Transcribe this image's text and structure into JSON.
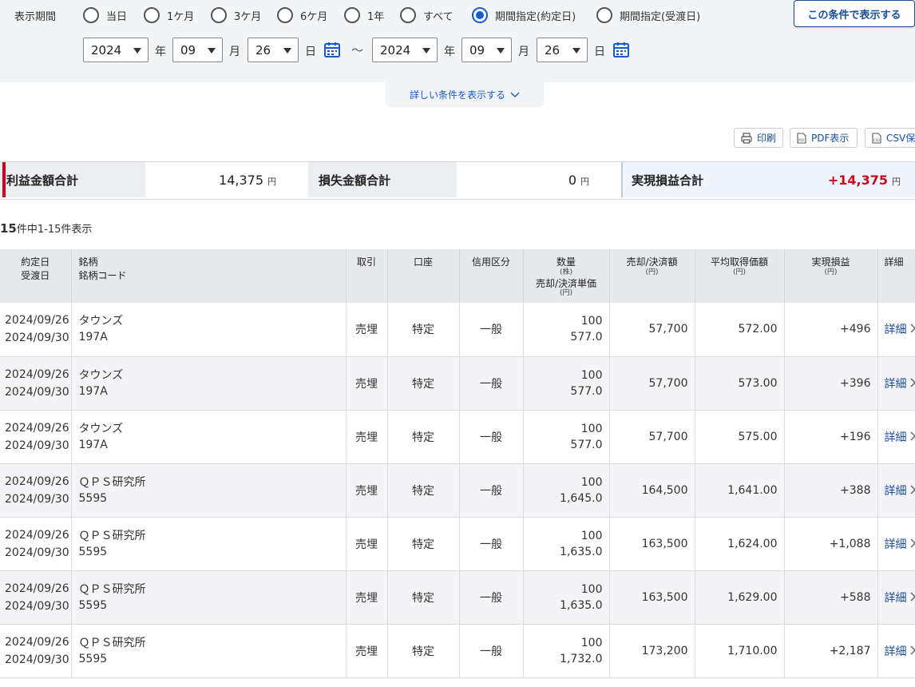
{
  "filter": {
    "period_label": "表示期間",
    "options": [
      "当日",
      "1ケ月",
      "3ケ月",
      "6ケ月",
      "1年",
      "すべて",
      "期間指定(約定日)",
      "期間指定(受渡日)"
    ],
    "selected_option": "期間指定(約定日)",
    "apply_button": "この条件で表示する",
    "from": {
      "year": "2024",
      "month": "09",
      "day": "26"
    },
    "to": {
      "year": "2024",
      "month": "09",
      "day": "26"
    },
    "unit_year": "年",
    "unit_month": "月",
    "unit_day": "日",
    "tilde": "～",
    "more_conditions": "詳しい条件を表示する"
  },
  "toolbar": {
    "print": "印刷",
    "pdf": "PDF表示",
    "csv": "CSV保存"
  },
  "summary": {
    "profit_label": "利益金額合計",
    "profit_value": "14,375",
    "loss_label": "損失金額合計",
    "loss_value": "0",
    "realized_label": "実現損益合計",
    "realized_value": "+14,375",
    "yen": "円"
  },
  "result_count": {
    "total": "15",
    "text": "件中1-15件表示"
  },
  "table": {
    "headers": {
      "trade_date": "約定日",
      "settle_date": "受渡日",
      "name": "銘柄",
      "code": "銘柄コード",
      "trade": "取引",
      "account": "口座",
      "margin": "信用区分",
      "qty": "数量",
      "qty_unit": "(株)",
      "unit_price": "売却/決済単価",
      "unit_price_unit": "(円)",
      "amount": "売却/決済額",
      "amount_unit": "(円)",
      "avg_cost": "平均取得価額",
      "avg_cost_unit": "(円)",
      "pl": "実現損益",
      "pl_unit": "(円)",
      "detail": "詳細"
    },
    "rows": [
      {
        "trade_date": "2024/09/26",
        "settle_date": "2024/09/30",
        "name": "タウンズ",
        "code": "197A",
        "trade": "売埋",
        "account": "特定",
        "margin": "一般",
        "qty": "100",
        "price": "577.0",
        "amount": "57,700",
        "avg": "572.00",
        "pl": "+496",
        "detail": "詳細"
      },
      {
        "trade_date": "2024/09/26",
        "settle_date": "2024/09/30",
        "name": "タウンズ",
        "code": "197A",
        "trade": "売埋",
        "account": "特定",
        "margin": "一般",
        "qty": "100",
        "price": "577.0",
        "amount": "57,700",
        "avg": "573.00",
        "pl": "+396",
        "detail": "詳細"
      },
      {
        "trade_date": "2024/09/26",
        "settle_date": "2024/09/30",
        "name": "タウンズ",
        "code": "197A",
        "trade": "売埋",
        "account": "特定",
        "margin": "一般",
        "qty": "100",
        "price": "577.0",
        "amount": "57,700",
        "avg": "575.00",
        "pl": "+196",
        "detail": "詳細"
      },
      {
        "trade_date": "2024/09/26",
        "settle_date": "2024/09/30",
        "name": "ＱＰＳ研究所",
        "code": "5595",
        "trade": "売埋",
        "account": "特定",
        "margin": "一般",
        "qty": "100",
        "price": "1,645.0",
        "amount": "164,500",
        "avg": "1,641.00",
        "pl": "+388",
        "detail": "詳細"
      },
      {
        "trade_date": "2024/09/26",
        "settle_date": "2024/09/30",
        "name": "ＱＰＳ研究所",
        "code": "5595",
        "trade": "売埋",
        "account": "特定",
        "margin": "一般",
        "qty": "100",
        "price": "1,635.0",
        "amount": "163,500",
        "avg": "1,624.00",
        "pl": "+1,088",
        "detail": "詳細"
      },
      {
        "trade_date": "2024/09/26",
        "settle_date": "2024/09/30",
        "name": "ＱＰＳ研究所",
        "code": "5595",
        "trade": "売埋",
        "account": "特定",
        "margin": "一般",
        "qty": "100",
        "price": "1,635.0",
        "amount": "163,500",
        "avg": "1,629.00",
        "pl": "+588",
        "detail": "詳細"
      },
      {
        "trade_date": "2024/09/26",
        "settle_date": "2024/09/30",
        "name": "ＱＰＳ研究所",
        "code": "5595",
        "trade": "売埋",
        "account": "特定",
        "margin": "一般",
        "qty": "100",
        "price": "1,732.0",
        "amount": "173,200",
        "avg": "1,710.00",
        "pl": "+2,187",
        "detail": "詳細"
      }
    ]
  },
  "colors": {
    "accent": "#1a5bcc",
    "profit": "#d0021b",
    "link": "#1a4d99"
  }
}
